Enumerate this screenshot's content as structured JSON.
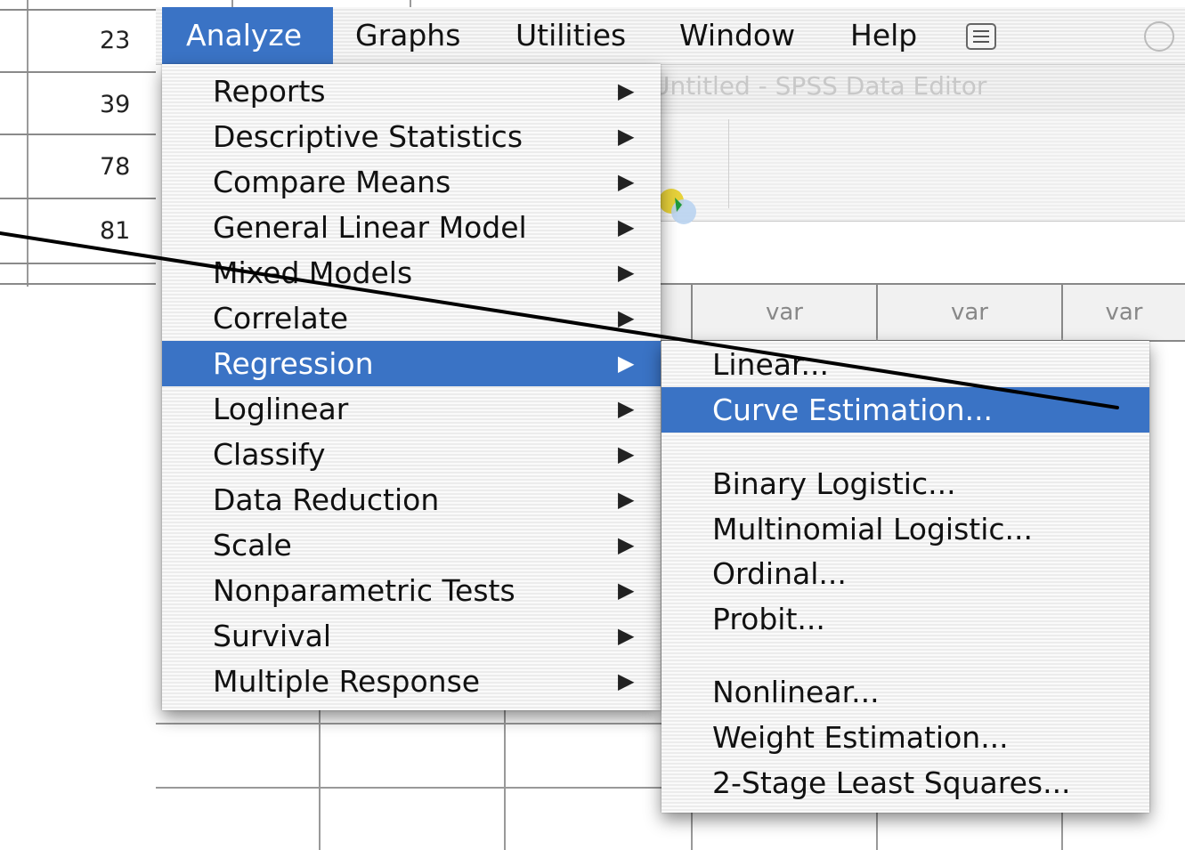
{
  "background_rows": [
    "23",
    "39",
    "78",
    "81"
  ],
  "menubar": {
    "items": [
      "Analyze",
      "Graphs",
      "Utilities",
      "Window",
      "Help"
    ],
    "active": "Analyze"
  },
  "editor": {
    "title": "Untitled - SPSS Data Editor",
    "column_headers": [
      "var",
      "var",
      "var"
    ]
  },
  "analyze_menu": {
    "items": [
      "Reports",
      "Descriptive Statistics",
      "Compare Means",
      "General Linear Model",
      "Mixed Models",
      "Correlate",
      "Regression",
      "Loglinear",
      "Classify",
      "Data Reduction",
      "Scale",
      "Nonparametric Tests",
      "Survival",
      "Multiple Response"
    ],
    "selected": "Regression"
  },
  "regression_submenu": {
    "items": [
      "Linear...",
      "Curve Estimation...",
      "Binary Logistic...",
      "Multinomial Logistic...",
      "Ordinal...",
      "Probit...",
      "Nonlinear...",
      "Weight Estimation...",
      "2-Stage Least Squares..."
    ],
    "selected": "Curve Estimation..."
  },
  "colors": {
    "highlight": "#3a73c5",
    "callout_line": "#000000"
  }
}
